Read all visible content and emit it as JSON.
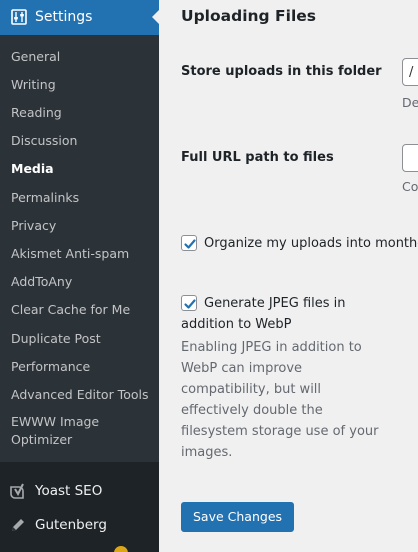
{
  "sidebar": {
    "settings_label": "Settings",
    "submenu": [
      {
        "label": "General"
      },
      {
        "label": "Writing"
      },
      {
        "label": "Reading"
      },
      {
        "label": "Discussion"
      },
      {
        "label": "Media",
        "current": true
      },
      {
        "label": "Permalinks"
      },
      {
        "label": "Privacy"
      },
      {
        "label": "Akismet Anti-spam"
      },
      {
        "label": "AddToAny"
      },
      {
        "label": "Clear Cache for Me"
      },
      {
        "label": "Duplicate Post"
      },
      {
        "label": "Performance"
      },
      {
        "label": "Advanced Editor Tools"
      },
      {
        "label": "EWWW Image Optimizer"
      }
    ],
    "menu": [
      {
        "label": "Yoast SEO",
        "icon": "yoast-icon"
      },
      {
        "label": "Gutenberg",
        "icon": "pencil-icon"
      }
    ]
  },
  "main": {
    "section_title": "Uploading Files",
    "store_uploads": {
      "label": "Store uploads in this folder",
      "value": "/",
      "description_peek": "De"
    },
    "full_url": {
      "label": "Full URL path to files",
      "value": "",
      "description_peek": "Co"
    },
    "organize_uploads": {
      "label": "Organize my uploads into month-",
      "checked": true
    },
    "generate_jpeg": {
      "label_line1": "Generate JPEG files in",
      "label_line2": "addition to WebP",
      "checked": true,
      "help_text": "Enabling JPEG in addition to WebP can improve compatibility, but will effectively double the filesystem storage use of your images."
    },
    "save_label": "Save Changes"
  },
  "colors": {
    "sidebar_bg": "#1d2327",
    "submenu_bg": "#2c3338",
    "accent": "#2271b1",
    "page_bg": "#f0f0f1"
  }
}
